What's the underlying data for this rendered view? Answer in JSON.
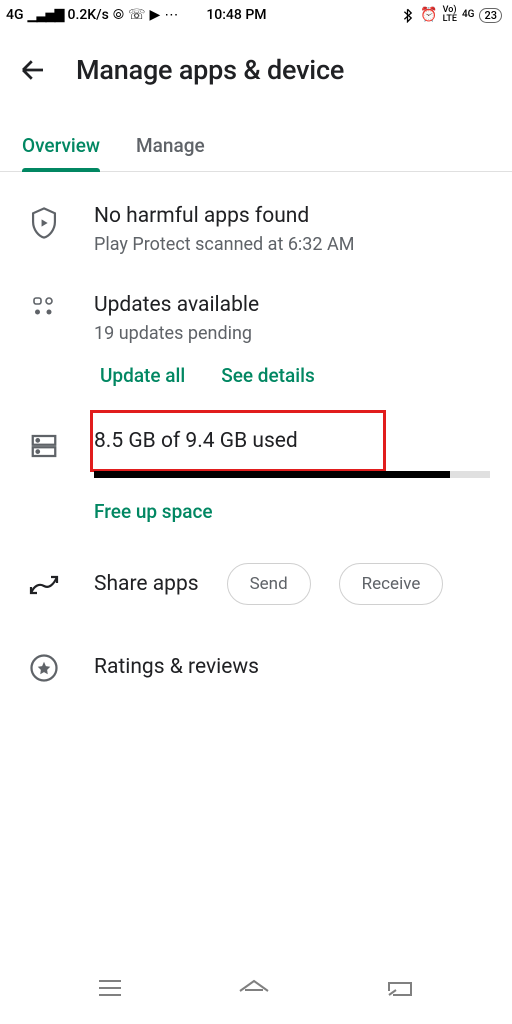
{
  "status": {
    "network": "4G",
    "speed": "0.2K/s",
    "time": "10:48 PM",
    "volte": "VoI\nLTE",
    "net2": "4G",
    "battery": "23"
  },
  "header": {
    "title": "Manage apps & device"
  },
  "tabs": {
    "overview": "Overview",
    "manage": "Manage"
  },
  "protect": {
    "title": "No harmful apps found",
    "sub": "Play Protect scanned at 6:32 AM"
  },
  "updates": {
    "title": "Updates available",
    "sub": "19 updates pending",
    "update_all": "Update all",
    "see_details": "See details"
  },
  "storage": {
    "line": "8.5 GB of 9.4 GB used",
    "percent": 90,
    "free_up": "Free up space"
  },
  "share": {
    "label": "Share apps",
    "send": "Send",
    "receive": "Receive"
  },
  "ratings": {
    "label": "Ratings & reviews"
  }
}
